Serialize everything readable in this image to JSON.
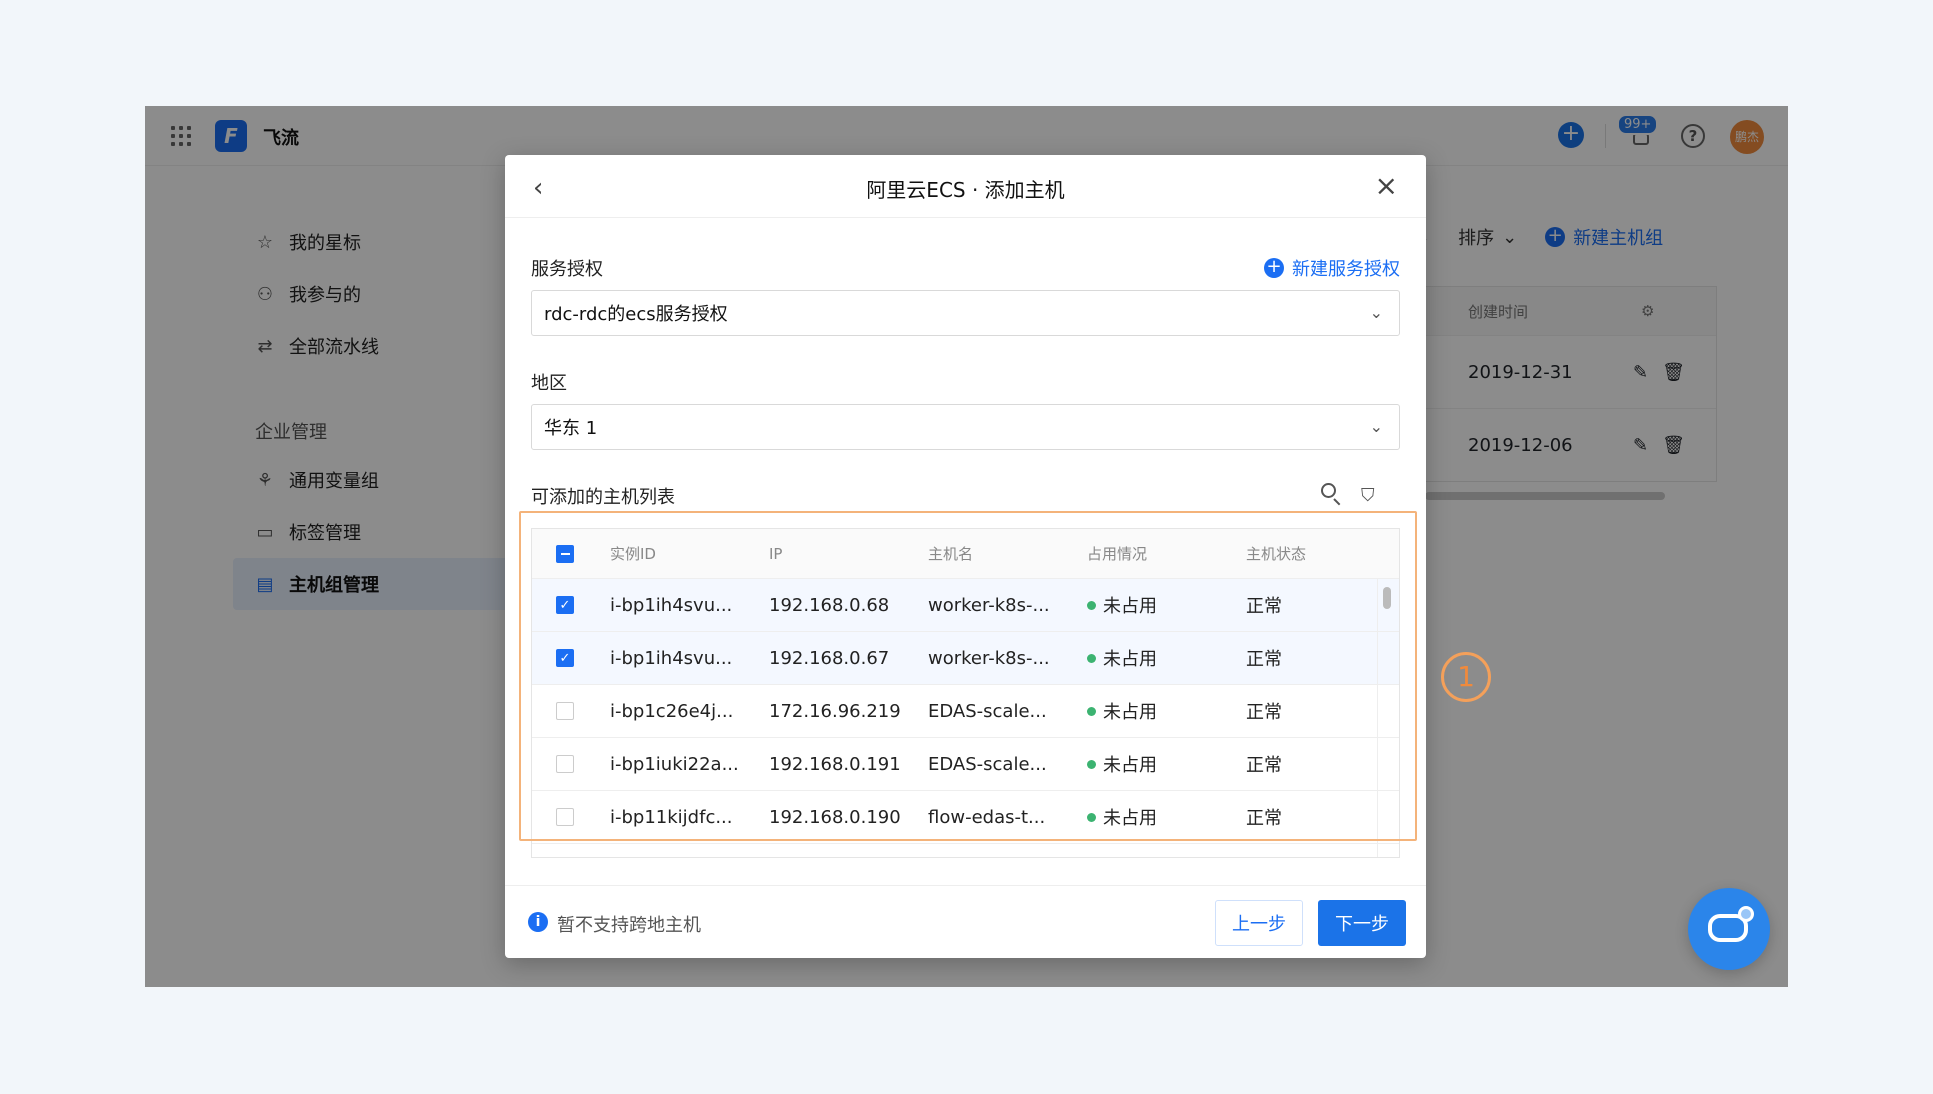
{
  "app": {
    "title": "飞流",
    "logo_letter": "F",
    "notification_count": "99+",
    "avatar_text": "鹏杰"
  },
  "sidebar": {
    "items": [
      {
        "label": "我的星标",
        "icon": "star-icon"
      },
      {
        "label": "我参与的",
        "icon": "user-icon"
      },
      {
        "label": "全部流水线",
        "icon": "swap-icon"
      }
    ],
    "group_label": "企业管理",
    "group_items": [
      {
        "label": "通用变量组",
        "icon": "nodes-icon"
      },
      {
        "label": "标签管理",
        "icon": "tag-icon"
      },
      {
        "label": "主机组管理",
        "icon": "host-group-icon",
        "active": true
      }
    ]
  },
  "background_page": {
    "sort_label": "排序",
    "new_group_label": "新建主机组",
    "column_created": "创建时间",
    "rows": [
      {
        "created": "2019-12-31"
      },
      {
        "created": "2019-12-06"
      }
    ]
  },
  "modal": {
    "title": "阿里云ECS · 添加主机",
    "auth_label": "服务授权",
    "new_auth_label": "新建服务授权",
    "auth_value": "rdc-rdc的ecs服务授权",
    "region_label": "地区",
    "region_value": "华东 1",
    "list_title": "可添加的主机列表",
    "columns": {
      "id": "实例ID",
      "ip": "IP",
      "name": "主机名",
      "usage": "占用情况",
      "status": "主机状态"
    },
    "rows": [
      {
        "id": "i-bp1ih4svu...",
        "ip": "192.168.0.68",
        "name": "worker-k8s-...",
        "usage": "未占用",
        "status": "正常",
        "checked": true
      },
      {
        "id": "i-bp1ih4svu...",
        "ip": "192.168.0.67",
        "name": "worker-k8s-...",
        "usage": "未占用",
        "status": "正常",
        "checked": true
      },
      {
        "id": "i-bp1c26e4j...",
        "ip": "172.16.96.219",
        "name": "EDAS-scale...",
        "usage": "未占用",
        "status": "正常",
        "checked": false
      },
      {
        "id": "i-bp1iuki22a...",
        "ip": "192.168.0.191",
        "name": "EDAS-scale...",
        "usage": "未占用",
        "status": "正常",
        "checked": false
      },
      {
        "id": "i-bp11kijdfc...",
        "ip": "192.168.0.190",
        "name": "flow-edas-t...",
        "usage": "未占用",
        "status": "正常",
        "checked": false
      }
    ],
    "footer_note": "暂不支持跨地主机",
    "prev_label": "上一步",
    "next_label": "下一步"
  },
  "annotation": {
    "callout_number": "1"
  },
  "colors": {
    "accent": "#1b6ef3",
    "highlight": "#f4b37a",
    "status_green": "#3cb371"
  }
}
